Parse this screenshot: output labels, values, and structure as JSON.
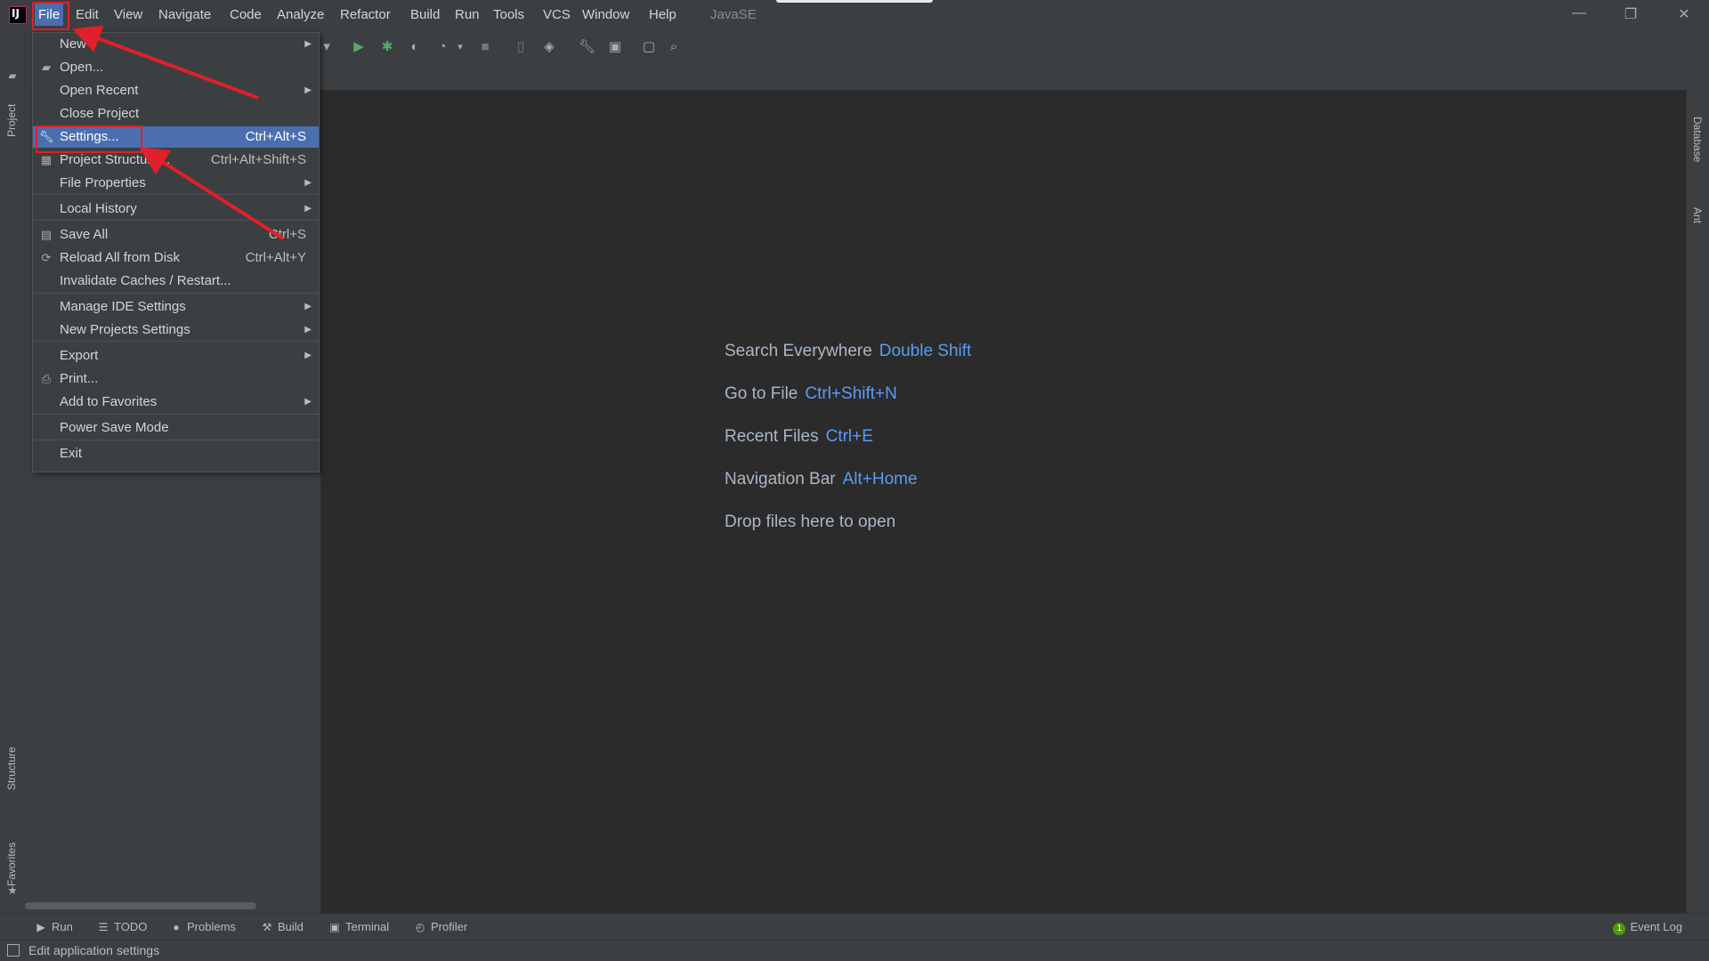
{
  "menubar": {
    "items": [
      "File",
      "Edit",
      "View",
      "Navigate",
      "Code",
      "Analyze",
      "Refactor",
      "Build",
      "Run",
      "Tools",
      "VCS",
      "Window",
      "Help"
    ],
    "window_title": "JavaSE"
  },
  "window_controls": {
    "minimize": "—",
    "restore": "❐",
    "close": "✕"
  },
  "file_menu": {
    "items": [
      {
        "label": "New",
        "shortcut": "",
        "submenu": true,
        "icon": ""
      },
      {
        "label": "Open...",
        "shortcut": "",
        "submenu": false,
        "icon": "folder-open-icon"
      },
      {
        "label": "Open Recent",
        "shortcut": "",
        "submenu": true,
        "icon": ""
      },
      {
        "label": "Close Project",
        "shortcut": "",
        "submenu": false,
        "icon": ""
      },
      {
        "label": "Settings...",
        "shortcut": "Ctrl+Alt+S",
        "submenu": false,
        "icon": "wrench-icon",
        "selected": true
      },
      {
        "label": "Project Structure...",
        "shortcut": "Ctrl+Alt+Shift+S",
        "submenu": false,
        "icon": "project-structure-icon"
      },
      {
        "label": "File Properties",
        "shortcut": "",
        "submenu": true,
        "icon": ""
      },
      {
        "label": "Local History",
        "shortcut": "",
        "submenu": true,
        "icon": ""
      },
      {
        "label": "Save All",
        "shortcut": "Ctrl+S",
        "submenu": false,
        "icon": "save-icon"
      },
      {
        "label": "Reload All from Disk",
        "shortcut": "Ctrl+Alt+Y",
        "submenu": false,
        "icon": "reload-icon"
      },
      {
        "label": "Invalidate Caches / Restart...",
        "shortcut": "",
        "submenu": false,
        "icon": ""
      },
      {
        "label": "Manage IDE Settings",
        "shortcut": "",
        "submenu": true,
        "icon": ""
      },
      {
        "label": "New Projects Settings",
        "shortcut": "",
        "submenu": true,
        "icon": ""
      },
      {
        "label": "Export",
        "shortcut": "",
        "submenu": true,
        "icon": ""
      },
      {
        "label": "Print...",
        "shortcut": "",
        "submenu": false,
        "icon": "print-icon"
      },
      {
        "label": "Add to Favorites",
        "shortcut": "",
        "submenu": true,
        "icon": ""
      },
      {
        "label": "Power Save Mode",
        "shortcut": "",
        "submenu": false,
        "icon": ""
      },
      {
        "label": "Exit",
        "shortcut": "",
        "submenu": false,
        "icon": ""
      }
    ]
  },
  "editor_hints": [
    {
      "label": "Search Everywhere",
      "key": "Double Shift"
    },
    {
      "label": "Go to File",
      "key": "Ctrl+Shift+N"
    },
    {
      "label": "Recent Files",
      "key": "Ctrl+E"
    },
    {
      "label": "Navigation Bar",
      "key": "Alt+Home"
    },
    {
      "label": "Drop files here to open",
      "key": ""
    }
  ],
  "side_tabs": {
    "left_top": "Project",
    "left_structure": "Structure",
    "left_favorites": "Favorites",
    "right_database": "Database",
    "right_ant": "Ant"
  },
  "bottom_tools": [
    "Run",
    "TODO",
    "Problems",
    "Build",
    "Terminal",
    "Profiler"
  ],
  "event_log": {
    "label": "Event Log",
    "count": "1"
  },
  "status": {
    "text": "Edit application settings"
  },
  "colors": {
    "accent": "#4b6eaf",
    "annotation": "#e0202a",
    "hint_key": "#589df6"
  }
}
